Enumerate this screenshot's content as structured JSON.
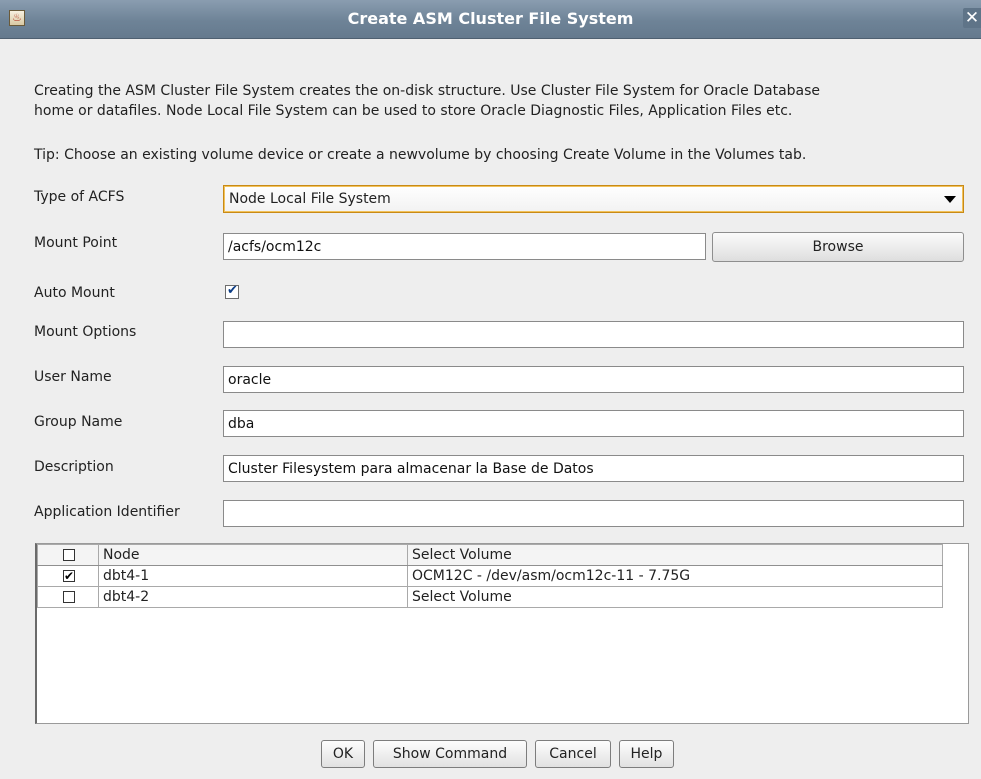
{
  "window": {
    "title": "Create ASM Cluster File System"
  },
  "intro": {
    "line1": "Creating the ASM Cluster File System creates the on-disk structure. Use Cluster File System for Oracle Database",
    "line2": "home or datafiles. Node Local File System can be used to store Oracle Diagnostic Files, Application Files etc.",
    "tip": "Tip: Choose an existing volume device or create a newvolume by choosing Create Volume in the Volumes tab."
  },
  "form": {
    "type_label": "Type of ACFS",
    "type_value": "Node Local File System",
    "mount_point_label": "Mount Point",
    "mount_point_value": "/acfs/ocm12c",
    "browse_label": "Browse",
    "auto_mount_label": "Auto Mount",
    "auto_mount_checked": true,
    "mount_options_label": "Mount Options",
    "mount_options_value": "",
    "user_name_label": "User Name",
    "user_name_value": "oracle",
    "group_name_label": "Group Name",
    "group_name_value": "dba",
    "description_label": "Description",
    "description_value": "Cluster Filesystem para almacenar la Base de Datos",
    "app_id_label": "Application Identifier",
    "app_id_value": ""
  },
  "table": {
    "headers": {
      "node": "Node",
      "volume": "Select Volume"
    },
    "header_checked": false,
    "rows": [
      {
        "checked": true,
        "node": "dbt4-1",
        "volume": "OCM12C - /dev/asm/ocm12c-11 - 7.75G"
      },
      {
        "checked": false,
        "node": "dbt4-2",
        "volume": "Select Volume"
      }
    ]
  },
  "buttons": {
    "ok": "OK",
    "show_command": "Show Command",
    "cancel": "Cancel",
    "help": "Help"
  }
}
